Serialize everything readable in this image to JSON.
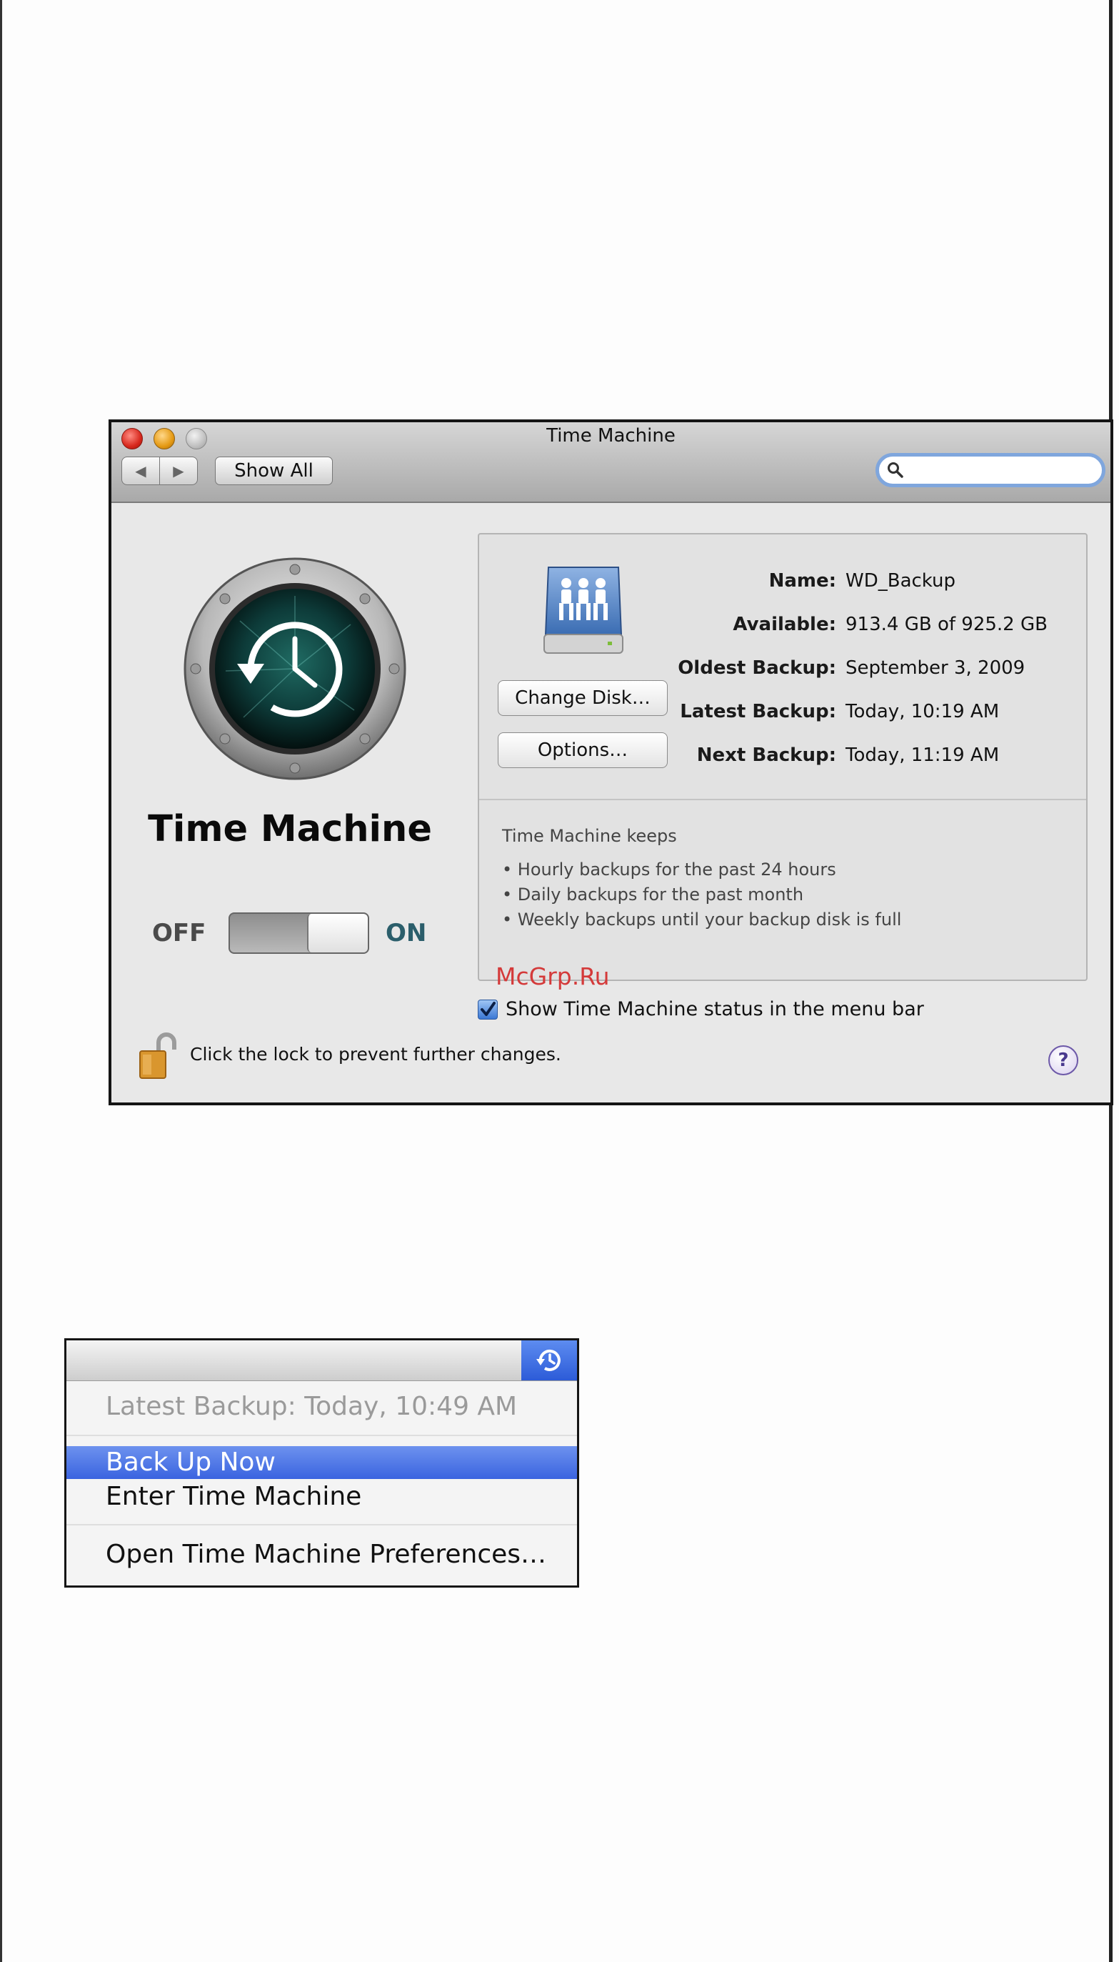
{
  "window": {
    "title": "Time Machine",
    "toolbar": {
      "back_icon": "◀",
      "forward_icon": "▶",
      "show_all_label": "Show All",
      "search_placeholder": ""
    },
    "app_name": "Time Machine",
    "switch": {
      "off_label": "OFF",
      "on_label": "ON",
      "state": "on"
    },
    "disk": {
      "rows": [
        {
          "label": "Name:",
          "value": "WD_Backup"
        },
        {
          "label": "Available:",
          "value": "913.4 GB of 925.2 GB"
        },
        {
          "label": "Oldest Backup:",
          "value": "September 3, 2009"
        },
        {
          "label": "Latest Backup:",
          "value": "Today, 10:19 AM"
        },
        {
          "label": "Next Backup:",
          "value": "Today, 11:19 AM"
        }
      ],
      "change_disk_label": "Change Disk…",
      "options_label": "Options…"
    },
    "keeps": {
      "title": "Time Machine keeps",
      "items": [
        "• Hourly backups for the past 24 hours",
        "• Daily backups for the past month",
        "• Weekly backups until your backup disk is full"
      ]
    },
    "status_checkbox": {
      "label": "Show Time Machine status in the menu bar",
      "checked": true
    },
    "lock_text": "Click the lock to prevent further changes.",
    "help_label": "?",
    "watermark": "McGrp.Ru"
  },
  "menu": {
    "items": [
      {
        "label": "Latest Backup: Today, 10:49 AM",
        "state": "disabled"
      },
      {
        "label": "Back Up Now",
        "state": "selected"
      },
      {
        "label": "Enter Time Machine",
        "state": "normal"
      },
      {
        "label": "Open Time Machine Preferences…",
        "state": "normal"
      }
    ]
  },
  "colors": {
    "menu_highlight": "#3a63e0",
    "switch_on_text": "#2b5e6b",
    "watermark": "#d43a3a"
  }
}
